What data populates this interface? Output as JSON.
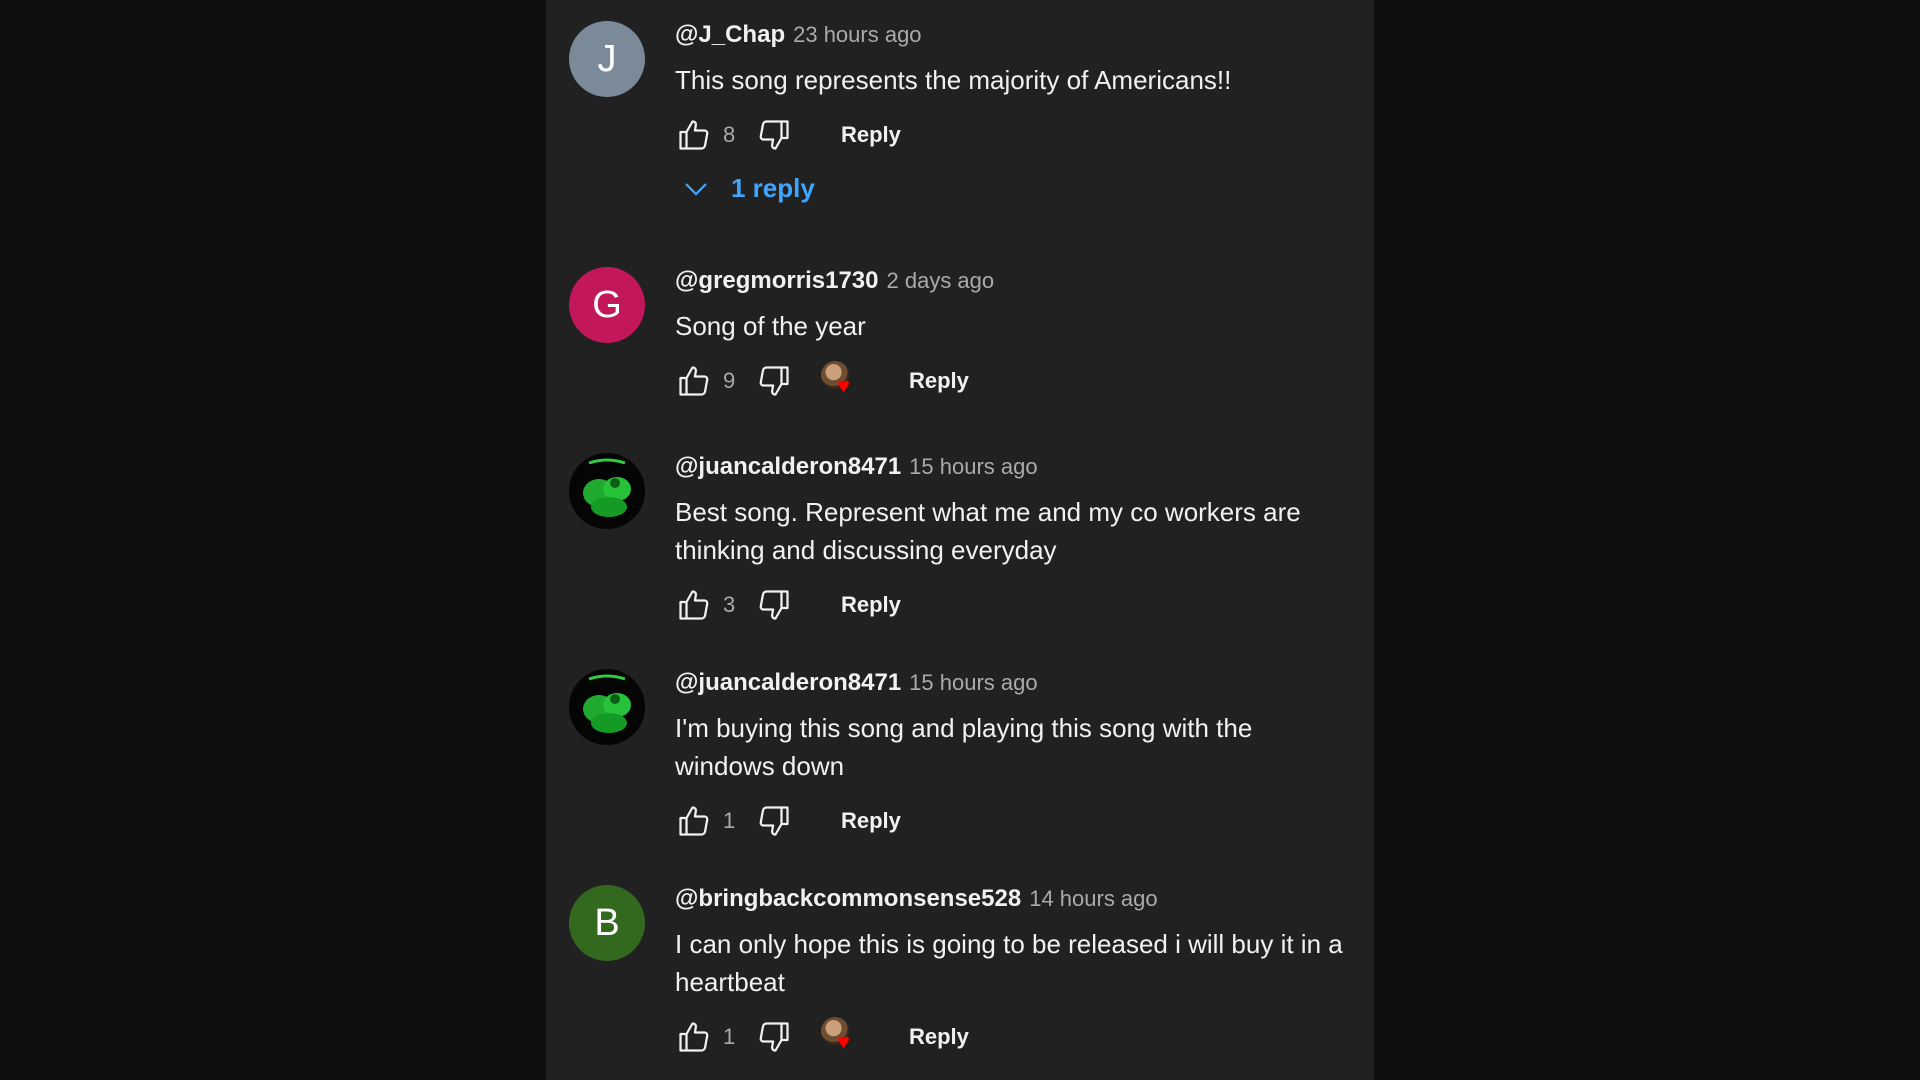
{
  "colors": {
    "page_background": "#0f0f0f",
    "panel_background": "#212121",
    "link_blue": "#3ea6ff",
    "heart_red": "#ff0000"
  },
  "comments": [
    {
      "avatar_letter": "J",
      "avatar_color": "#7b8a99",
      "author": "@J_Chap",
      "time": "23 hours ago",
      "text": "This song represents the majority of Americans!!",
      "likes": "8",
      "reply_label": "Reply",
      "replies_label": "1 reply",
      "creator_heart": false
    },
    {
      "avatar_letter": "G",
      "avatar_color": "#c2185b",
      "author": "@gregmorris1730",
      "time": "2 days ago",
      "text": "Song of the year",
      "likes": "9",
      "reply_label": "Reply",
      "creator_heart": true
    },
    {
      "avatar_letter": "",
      "avatar_icon": "green-hulk-avatar",
      "author": "@juancalderon8471",
      "time": "15 hours ago",
      "text": "Best song. Represent what me and my co workers are thinking and discussing everyday",
      "likes": "3",
      "reply_label": "Reply",
      "creator_heart": false
    },
    {
      "avatar_letter": "",
      "avatar_icon": "green-hulk-avatar",
      "author": "@juancalderon8471",
      "time": "15 hours ago",
      "text": "I'm buying this song and playing this song with the windows down",
      "likes": "1",
      "reply_label": "Reply",
      "creator_heart": false
    },
    {
      "avatar_letter": "B",
      "avatar_color": "#33691e",
      "author": "@bringbackcommonsense528",
      "time": "14 hours ago",
      "text": "I can only hope this is going to be released i will buy it in a heartbeat",
      "likes": "1",
      "reply_label": "Reply",
      "creator_heart": true
    }
  ]
}
